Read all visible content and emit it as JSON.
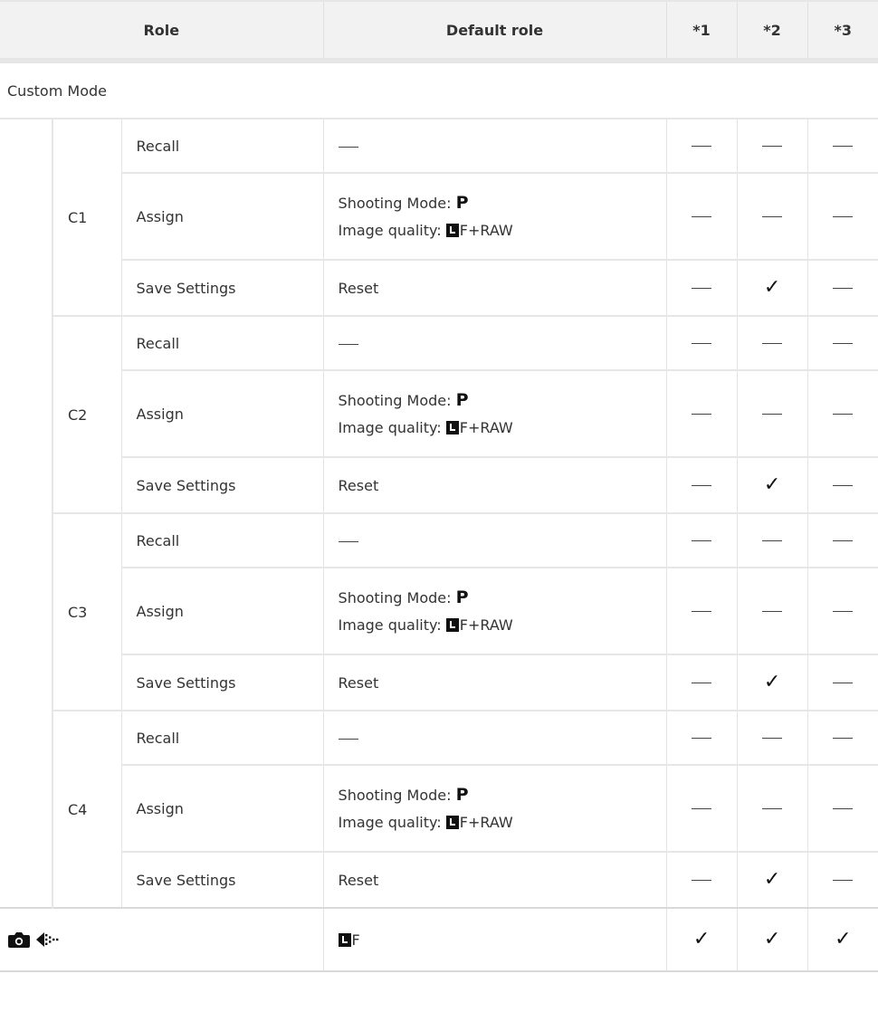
{
  "header": {
    "role": "Role",
    "default_role": "Default role",
    "n1": "*1",
    "n2": "*2",
    "n3": "*3"
  },
  "section_title": "Custom Mode",
  "groups": [
    {
      "name": "C1",
      "recall": {
        "label": "Recall",
        "marks": [
          "dash",
          "dash",
          "dash"
        ]
      },
      "assign": {
        "label": "Assign",
        "line1_prefix": "Shooting Mode: ",
        "mode": "P",
        "line2_prefix": "Image quality: ",
        "quality": "F+RAW",
        "marks": [
          "dash",
          "dash",
          "dash"
        ]
      },
      "save": {
        "label": "Save Settings",
        "value": "Reset",
        "marks": [
          "dash",
          "check",
          "dash"
        ]
      }
    },
    {
      "name": "C2",
      "recall": {
        "label": "Recall",
        "marks": [
          "dash",
          "dash",
          "dash"
        ]
      },
      "assign": {
        "label": "Assign",
        "line1_prefix": "Shooting Mode: ",
        "mode": "P",
        "line2_prefix": "Image quality: ",
        "quality": "F+RAW",
        "marks": [
          "dash",
          "dash",
          "dash"
        ]
      },
      "save": {
        "label": "Save Settings",
        "value": "Reset",
        "marks": [
          "dash",
          "check",
          "dash"
        ]
      }
    },
    {
      "name": "C3",
      "recall": {
        "label": "Recall",
        "marks": [
          "dash",
          "dash",
          "dash"
        ]
      },
      "assign": {
        "label": "Assign",
        "line1_prefix": "Shooting Mode: ",
        "mode": "P",
        "line2_prefix": "Image quality: ",
        "quality": "F+RAW",
        "marks": [
          "dash",
          "dash",
          "dash"
        ]
      },
      "save": {
        "label": "Save Settings",
        "value": "Reset",
        "marks": [
          "dash",
          "check",
          "dash"
        ]
      }
    },
    {
      "name": "C4",
      "recall": {
        "label": "Recall",
        "marks": [
          "dash",
          "dash",
          "dash"
        ]
      },
      "assign": {
        "label": "Assign",
        "line1_prefix": "Shooting Mode: ",
        "mode": "P",
        "line2_prefix": "Image quality: ",
        "quality": "F+RAW",
        "marks": [
          "dash",
          "dash",
          "dash"
        ]
      },
      "save": {
        "label": "Save Settings",
        "value": "Reset",
        "marks": [
          "dash",
          "check",
          "dash"
        ]
      }
    }
  ],
  "last_row": {
    "icons": [
      "camera-icon",
      "sequential-shooting-icon"
    ],
    "value": "F",
    "marks": [
      "check",
      "check",
      "check"
    ]
  }
}
